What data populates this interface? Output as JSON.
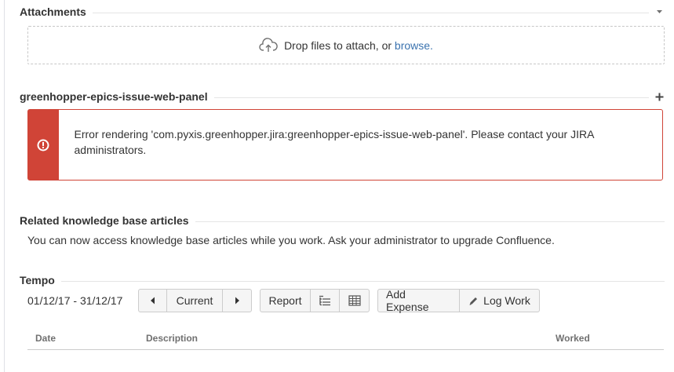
{
  "attachments": {
    "title": "Attachments",
    "drop_text": "Drop files to attach, or",
    "browse_label": "browse."
  },
  "epics_panel": {
    "title": "greenhopper-epics-issue-web-panel",
    "error_message": "Error rendering 'com.pyxis.greenhopper.jira:greenhopper-epics-issue-web-panel'. Please contact your JIRA administrators.",
    "error_color": "#d04437"
  },
  "kb": {
    "title": "Related knowledge base articles",
    "message": "You can now access knowledge base articles while you work. Ask your administrator to upgrade Confluence."
  },
  "tempo": {
    "title": "Tempo",
    "date_range": "01/12/17 - 31/12/17",
    "current_label": "Current",
    "report_label": "Report",
    "add_expense_label": "Add Expense",
    "log_work_label": "Log Work",
    "columns": [
      "Date",
      "Description",
      "Worked"
    ]
  },
  "icons": {
    "collapse": "chevron-down-icon",
    "add": "plus-icon",
    "upload": "cloud-upload-icon",
    "error": "error-icon",
    "prev": "arrow-left-icon",
    "next": "arrow-right-icon",
    "list": "list-view-icon",
    "grid": "grid-view-icon",
    "pencil": "pencil-icon"
  }
}
